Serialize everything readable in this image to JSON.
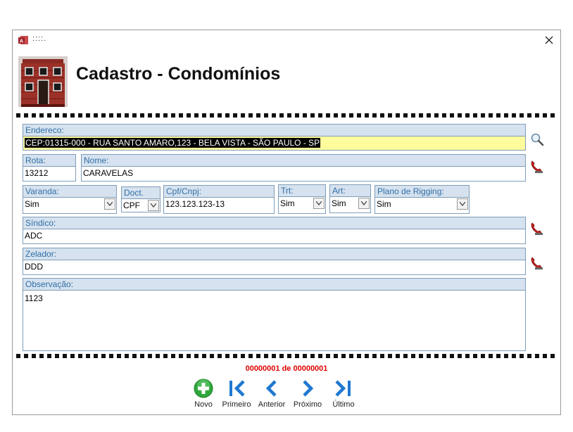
{
  "window": {
    "title": "::::.",
    "close_symbol": "✕"
  },
  "header": {
    "title": "Cadastro - Condomínios",
    "image": "building-icon"
  },
  "form": {
    "endereco": {
      "label": "Endereco:",
      "value": "CEP:01315-000 - RUA SANTO AMARO,123 - BELA VISTA - SÃO PAULO - SP"
    },
    "rota": {
      "label": "Rota:",
      "value": "13212"
    },
    "nome": {
      "label": "Nome:",
      "value": "CARAVELAS"
    },
    "varanda": {
      "label": "Varanda:",
      "value": "Sim"
    },
    "doct": {
      "label": "Doct.",
      "value": "CPF"
    },
    "cpf_cnpj": {
      "label": "Cpf/Cnpj:",
      "value": "123.123.123-13"
    },
    "trt": {
      "label": "Trt:",
      "value": "Sim"
    },
    "art": {
      "label": "Art:",
      "value": "Sim"
    },
    "plano_rigging": {
      "label": "Plano de Rigging:",
      "value": "Sim"
    },
    "sindico": {
      "label": "Síndico:",
      "value": "ADC"
    },
    "zelador": {
      "label": "Zelador:",
      "value": "DDD"
    },
    "observacao": {
      "label": "Observação:",
      "value": "1123"
    }
  },
  "side_icons": [
    "magnifier-icon",
    "phone-icon",
    "phone-icon",
    "phone-icon"
  ],
  "record_counter": "00000001 de 00000001",
  "nav": {
    "novo": "Novo",
    "primeiro": "Primeiro",
    "anterior": "Anterior",
    "proximo": "Próximo",
    "ultimo": "Último"
  },
  "colors": {
    "label_bg": "#d6e2ef",
    "label_text": "#2f6fa6",
    "highlight_bg": "#fffc9e",
    "counter_red": "#e00000",
    "nav_blue": "#1f78d1",
    "novo_green": "#2fa73a"
  }
}
